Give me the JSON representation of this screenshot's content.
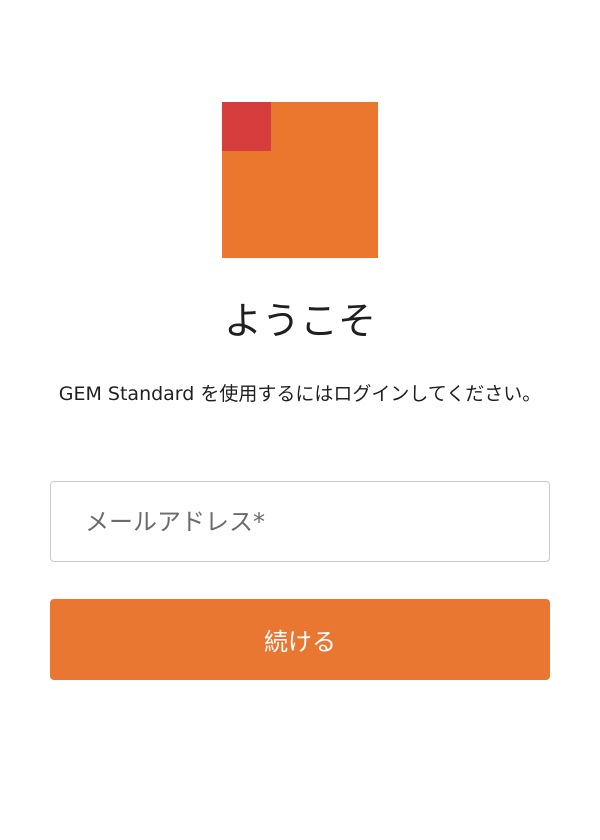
{
  "logo": {
    "name": "brand-logo",
    "primary_color": "#ea772d",
    "accent_color": "#d63d3d"
  },
  "header": {
    "title": "ようこそ",
    "subtitle": "GEM Standard を使用するにはログインしてください。"
  },
  "form": {
    "email_placeholder": "メールアドレス*",
    "email_value": "",
    "continue_label": "続ける",
    "button_color": "#ea7731"
  }
}
